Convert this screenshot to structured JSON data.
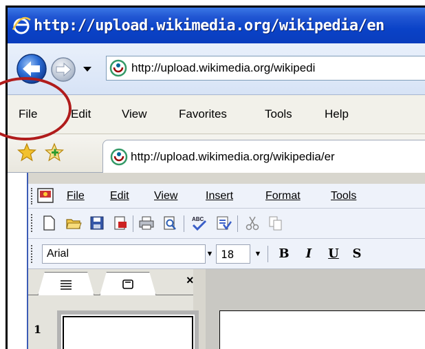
{
  "window": {
    "title": "http://upload.wikimedia.org/wikipedia/en"
  },
  "navigation": {
    "address": "http://upload.wikimedia.org/wikipedi",
    "back_icon": "back-arrow-icon",
    "forward_icon": "forward-arrow-icon"
  },
  "menu": {
    "items": [
      {
        "label": "File"
      },
      {
        "label": "Edit"
      },
      {
        "label": "View"
      },
      {
        "label": "Favorites"
      },
      {
        "label": "Tools"
      },
      {
        "label": "Help"
      }
    ],
    "highlight_color": "#b01c1c"
  },
  "tabs": {
    "active_tab_label": "http://upload.wikimedia.org/wikipedia/er"
  },
  "app": {
    "menu": [
      "File",
      "Edit",
      "View",
      "Insert",
      "Format",
      "Tools"
    ],
    "font": "Arial",
    "font_size": "18",
    "format_buttons": [
      "B",
      "I",
      "U",
      "S"
    ],
    "slide_number": "1",
    "close_label": "×"
  },
  "colors": {
    "title_bar": "#0a42c7",
    "accent_red": "#b01c1c"
  }
}
